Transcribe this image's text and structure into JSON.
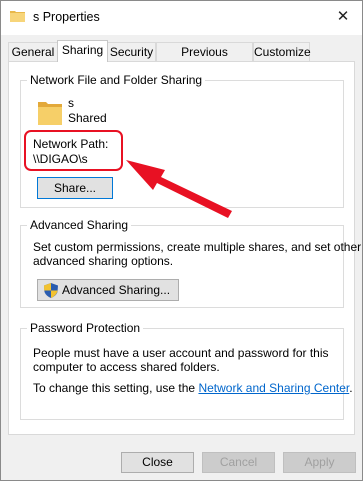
{
  "window": {
    "title": "s Properties",
    "close_glyph": "✕"
  },
  "tabs": [
    {
      "label": "General"
    },
    {
      "label": "Sharing"
    },
    {
      "label": "Security"
    },
    {
      "label": "Previous Versions"
    },
    {
      "label": "Customize"
    }
  ],
  "sharing": {
    "group_title": "Network File and Folder Sharing",
    "folder_name": "s",
    "folder_status": "Shared",
    "network_path_label": "Network Path:",
    "network_path_value": "\\\\DIGAO\\s",
    "share_button": "Share..."
  },
  "advanced": {
    "group_title": "Advanced Sharing",
    "description_line1": "Set custom permissions, create multiple shares, and set other",
    "description_line2": "advanced sharing options.",
    "button": "Advanced Sharing..."
  },
  "password": {
    "group_title": "Password Protection",
    "line1": "People must have a user account and password for this",
    "line2": "computer to access shared folders.",
    "change_text": "To change this setting, use the ",
    "link": "Network and Sharing Center",
    "period": "."
  },
  "footer": {
    "close": "Close",
    "cancel": "Cancel",
    "apply": "Apply"
  },
  "annotation": {
    "color": "#e81123"
  }
}
